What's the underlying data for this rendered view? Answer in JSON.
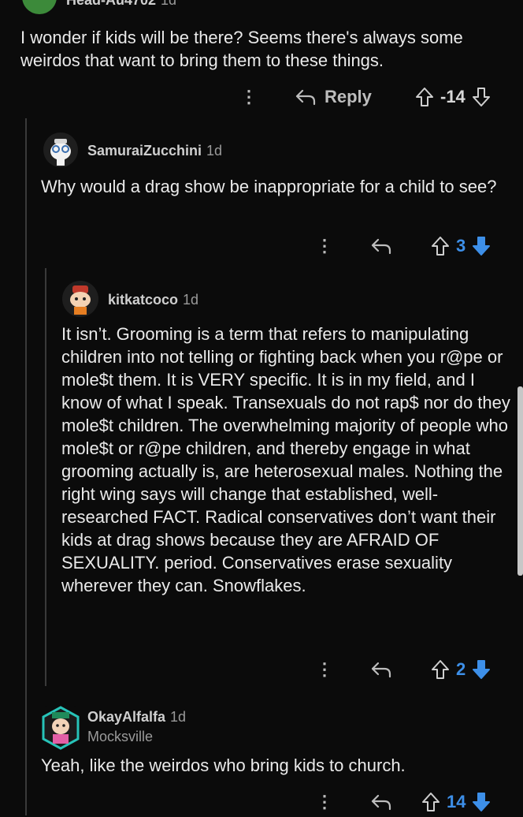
{
  "top_comment": {
    "username_partial": "Head-Au4702",
    "time": "1d",
    "text": "I wonder if kids will be there? Seems there's always some weirdos that want to bring them to these things.",
    "reply_label": "Reply",
    "score": "-14"
  },
  "comment_samurai": {
    "username": "SamuraiZucchini",
    "time": "1d",
    "text": "Why would a drag show be inappropriate for a child to see?",
    "score": "3"
  },
  "comment_kitkat": {
    "username": "kitkatcoco",
    "time": "1d",
    "text": "It isn’t. Grooming is a term that refers to manipulating children into not telling or fighting back when you r@pe or mole$t them. It is VERY specific. It is in my field, and I know of what I speak. Transexuals do not rap$ nor do they mole$t children. The overwhelming majority of people who mole$t or r@pe children, and thereby engage in what grooming actually is, are heterosexual males. Nothing the right wing says will change that established, well-researched FACT. Radical conservatives don’t want their kids at drag shows because they are AFRAID OF SEXUALITY. period. Conservatives erase sexuality wherever they can. Snowflakes.",
    "score": "2"
  },
  "comment_alfalfa": {
    "username": "OkayAlfalfa",
    "time": "1d",
    "flair": "Mocksville",
    "text": "Yeah, like the weirdos who bring kids to church.",
    "score": "14"
  },
  "colors": {
    "background": "#0b0b0b",
    "downvote_blue": "#3d8fe8",
    "text": "#eaeaea",
    "muted": "#9a9a9a"
  }
}
